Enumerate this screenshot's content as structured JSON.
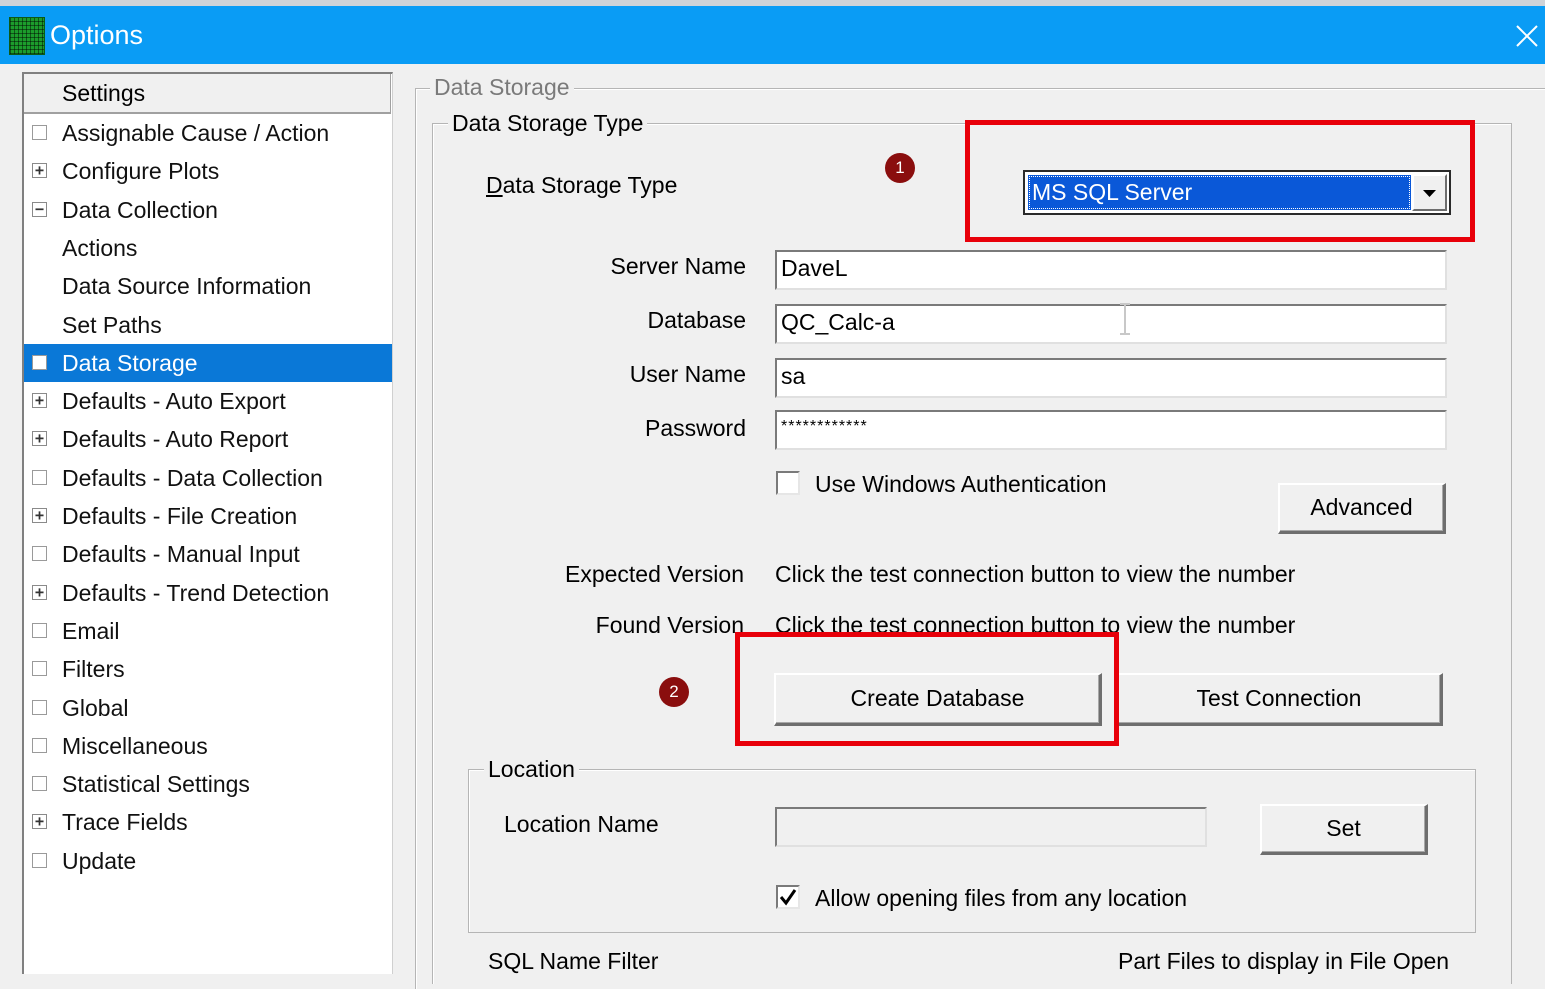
{
  "window": {
    "title": "Options",
    "close_glyph": "✕"
  },
  "tree": {
    "header": "Settings",
    "items": [
      {
        "label": "Assignable Cause / Action",
        "box": ""
      },
      {
        "label": "Configure Plots",
        "box": "+"
      },
      {
        "label": "Data Collection",
        "box": "−"
      },
      {
        "label": "Actions",
        "box": null
      },
      {
        "label": "Data Source Information",
        "box": null
      },
      {
        "label": "Set Paths",
        "box": null
      },
      {
        "label": "Data Storage",
        "box": "",
        "selected": true
      },
      {
        "label": "Defaults - Auto Export",
        "box": "+"
      },
      {
        "label": "Defaults - Auto Report",
        "box": "+"
      },
      {
        "label": "Defaults - Data Collection",
        "box": ""
      },
      {
        "label": "Defaults - File Creation",
        "box": "+"
      },
      {
        "label": "Defaults - Manual Input",
        "box": ""
      },
      {
        "label": "Defaults - Trend Detection",
        "box": "+"
      },
      {
        "label": "Email",
        "box": ""
      },
      {
        "label": "Filters",
        "box": ""
      },
      {
        "label": "Global",
        "box": ""
      },
      {
        "label": "Miscellaneous",
        "box": ""
      },
      {
        "label": "Statistical Settings",
        "box": ""
      },
      {
        "label": "Trace Fields",
        "box": "+"
      },
      {
        "label": "Update",
        "box": ""
      }
    ]
  },
  "data_storage": {
    "group_title": "Data Storage",
    "type_group_title": "Data Storage Type",
    "type_label_first": "D",
    "type_label_rest": "ata Storage Type",
    "type_value": "MS SQL Server",
    "server_label": "Server Name",
    "server_value": "DaveL",
    "database_label": "Database",
    "database_value": "QC_Calc-a",
    "user_label": "User Name",
    "user_value": "sa",
    "password_label": "Password",
    "password_value": "************",
    "windows_auth_label": "Use Windows Authentication",
    "windows_auth_checked": false,
    "advanced_button": "Advanced",
    "expected_label": "Expected Version",
    "expected_value": "Click the test connection button to view the number",
    "found_label": "Found Version",
    "found_value": "Click the test connection button to view the number",
    "create_button": "Create Database",
    "test_button": "Test Connection"
  },
  "location": {
    "group_title": "Location",
    "name_label": "Location Name",
    "name_value": "",
    "set_button": "Set",
    "allow_label": "Allow opening files from any location",
    "allow_checked": true
  },
  "bottom": {
    "sql_filter_label": "SQL Name Filter",
    "part_files_label": "Part Files to display in File Open"
  },
  "annotations": {
    "badge1": "1",
    "badge2": "2"
  },
  "colors": {
    "titlebar": "#0a9cf5",
    "selection": "#0a78d7",
    "highlight_box": "#e8000a",
    "badge": "#8a0e0e"
  }
}
